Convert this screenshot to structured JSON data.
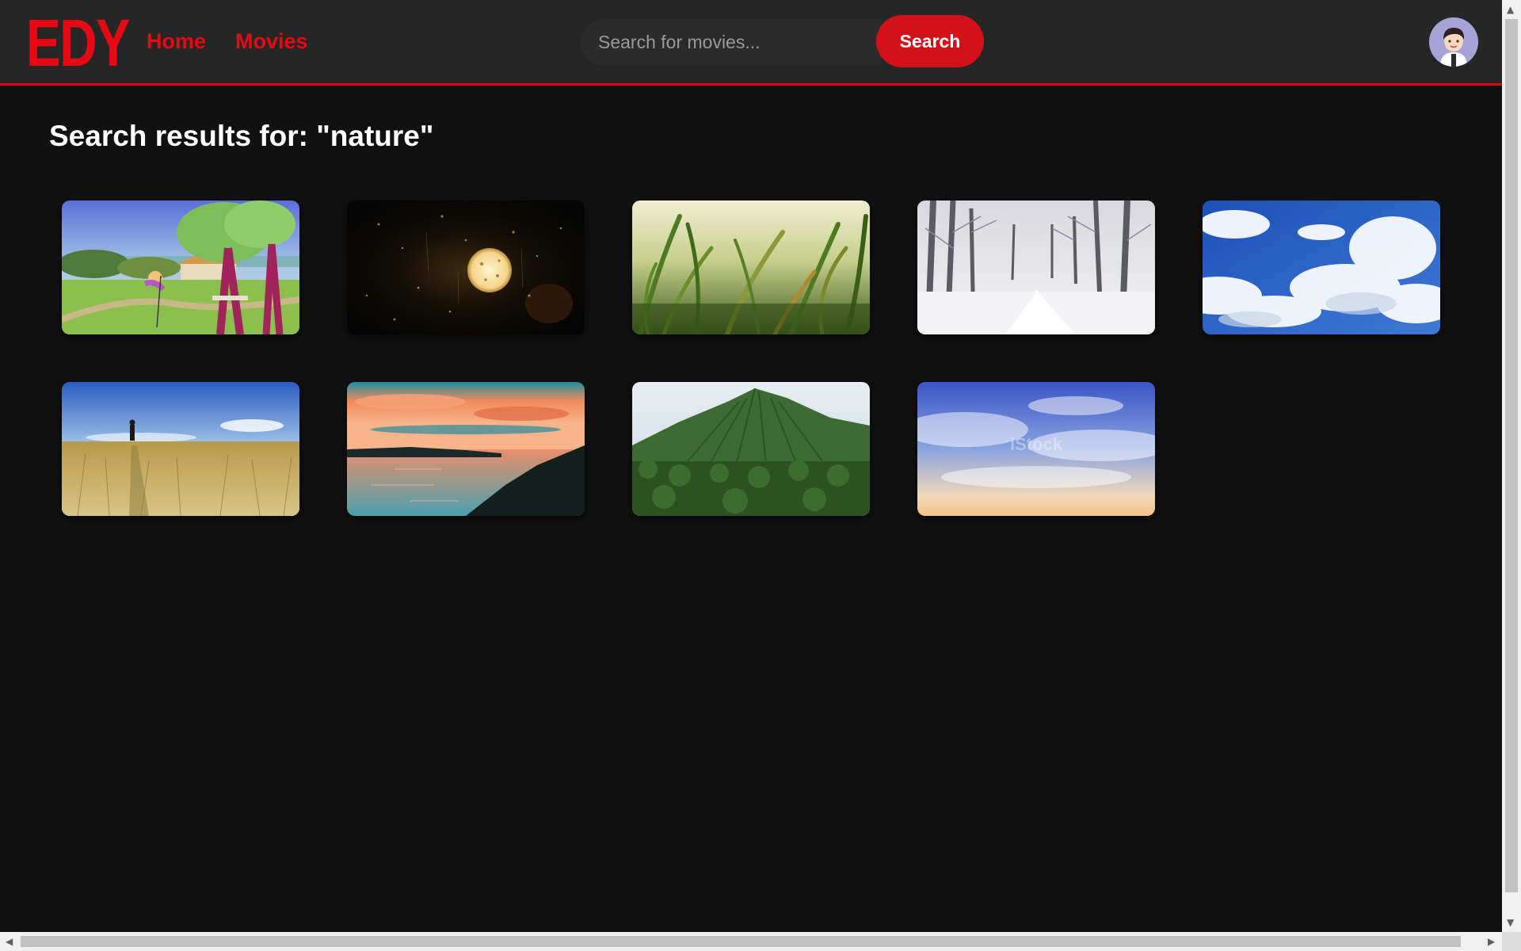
{
  "header": {
    "logo": "EDY",
    "nav": [
      {
        "label": "Home"
      },
      {
        "label": "Movies"
      }
    ],
    "search": {
      "placeholder": "Search for movies...",
      "value": ""
    },
    "search_button": "Search",
    "avatar_icon": "user-avatar-icon",
    "accent_color": "#e50914"
  },
  "main": {
    "heading": "Search results for: \"nature\"",
    "results": [
      {
        "thumbnail": "cartoon-garden-thumbnail"
      },
      {
        "thumbnail": "rainy-night-moon-thumbnail"
      },
      {
        "thumbnail": "grass-closeup-thumbnail"
      },
      {
        "thumbnail": "snowy-forest-thumbnail"
      },
      {
        "thumbnail": "blue-sky-clouds-thumbnail"
      },
      {
        "thumbnail": "wheat-field-walker-thumbnail"
      },
      {
        "thumbnail": "sunset-lake-thumbnail"
      },
      {
        "thumbnail": "green-mountain-thumbnail"
      },
      {
        "thumbnail": "sky-clouds-istock-thumbnail",
        "watermark": "iStock"
      }
    ]
  }
}
